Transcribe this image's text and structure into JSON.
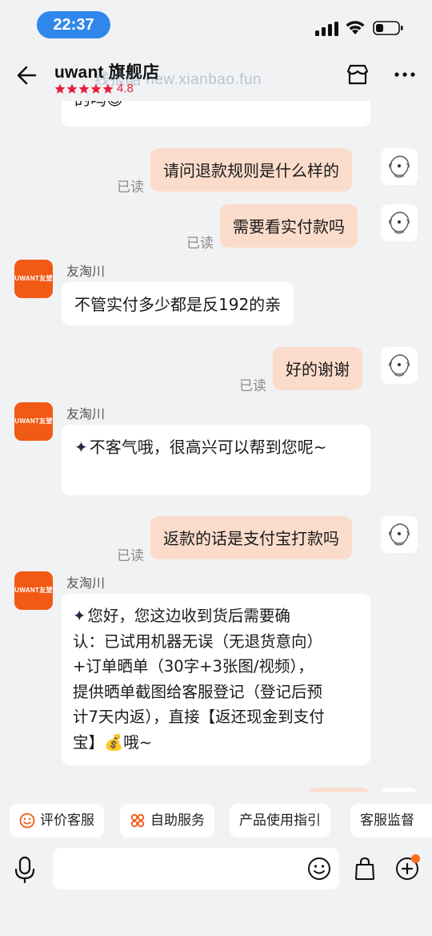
{
  "status_bar": {
    "time": "22:37"
  },
  "header": {
    "shop_name": "uwant 旗舰店",
    "rating": "4.8",
    "watermark": "线报酷 new.xianbao.fun"
  },
  "chat": {
    "partial_text": "的吗😊~",
    "read_label": "已读",
    "shop_avatar_text": "UWANT友望",
    "sender_name": "友淘川",
    "messages": [
      {
        "text": "请问退款规则是什么样的"
      },
      {
        "text": "需要看实付款吗"
      },
      {
        "text": "不管实付多少都是反192的亲"
      },
      {
        "text": "好的谢谢"
      },
      {
        "text": "不客气哦，很高兴可以帮到您呢~"
      },
      {
        "text": "返款的话是支付宝打款吗"
      },
      {
        "lines": [
          "您好，您这边收到货后需要确",
          "认：已试用机器无误（无退货意向）",
          "+订单晒单（30字+3张图/视频），",
          "提供晒单截图给客服登记（登记后预",
          "计7天内返），直接【返还现金到支付",
          "宝】💰哦~"
        ]
      }
    ]
  },
  "quick_actions": [
    {
      "label": "评价客服",
      "icon": "smile-icon"
    },
    {
      "label": "自助服务",
      "icon": "grid-flower-icon"
    },
    {
      "label": "产品使用指引"
    },
    {
      "label": "客服监督"
    }
  ],
  "input": {
    "placeholder": ""
  },
  "colors": {
    "accent": "#f15a14",
    "peach": "#fbdccb",
    "star": "#e81e3a",
    "time_pill": "#2f87ec"
  }
}
